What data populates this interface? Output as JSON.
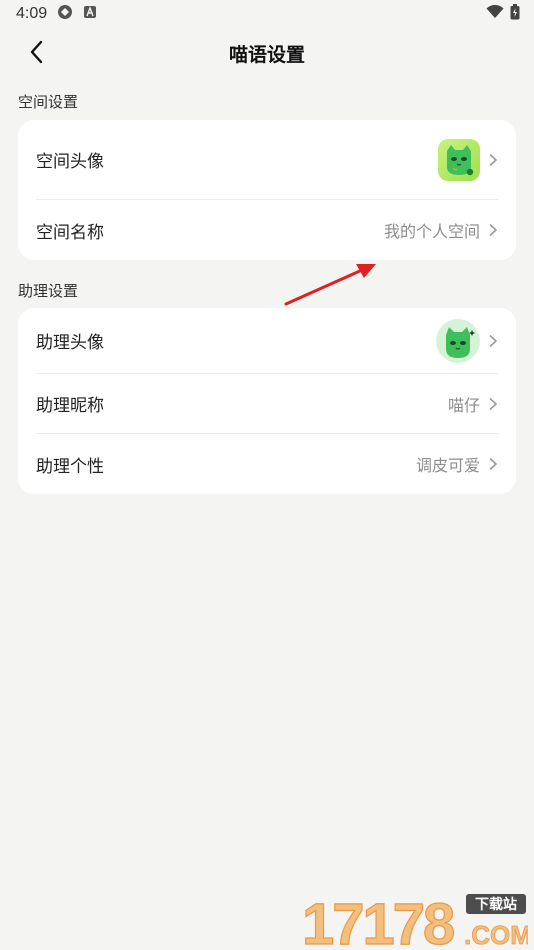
{
  "status_bar": {
    "time": "4:09"
  },
  "header": {
    "title": "喵语设置"
  },
  "space_section": {
    "label": "空间设置",
    "rows": [
      {
        "label": "空间头像",
        "value": ""
      },
      {
        "label": "空间名称",
        "value": "我的个人空间"
      }
    ]
  },
  "assistant_section": {
    "label": "助理设置",
    "rows": [
      {
        "label": "助理头像",
        "value": ""
      },
      {
        "label": "助理昵称",
        "value": "喵仔"
      },
      {
        "label": "助理个性",
        "value": "调皮可爱"
      }
    ]
  },
  "watermark": {
    "number": "17178",
    "top_text": "下载站",
    "domain": ".COM"
  },
  "colors": {
    "background": "#f4f5f3",
    "card": "#ffffff",
    "cat_green": "#3fbf5b",
    "annotation_red": "#e02020"
  }
}
